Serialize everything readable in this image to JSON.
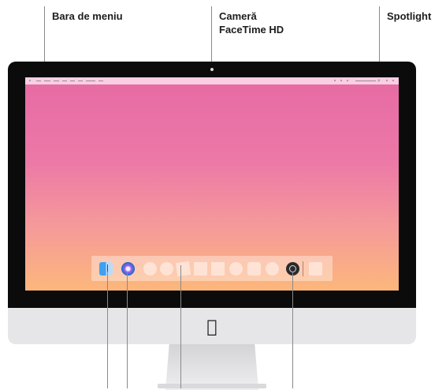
{
  "callouts": {
    "menu_bar": "Bara de meniu",
    "camera_line1": "Cameră",
    "camera_line2": "FaceTime HD",
    "spotlight": "Spotlight"
  },
  "dock": {
    "apps": [
      "finder-icon",
      "siri-icon",
      "app-icon",
      "app-icon",
      "app-icon",
      "app-icon",
      "app-icon",
      "app-icon",
      "app-icon",
      "system-preferences-icon",
      "app-icon"
    ]
  },
  "colors": {
    "wallpaper_top": "#e66aa4",
    "wallpaper_bottom": "#fcb77b",
    "bezel": "#0b0b0c",
    "chin": "#e6e6e8",
    "leader_line": "#8a8a8a"
  },
  "icons": {
    "apple_logo": "",
    "spotlight": "⌕"
  }
}
